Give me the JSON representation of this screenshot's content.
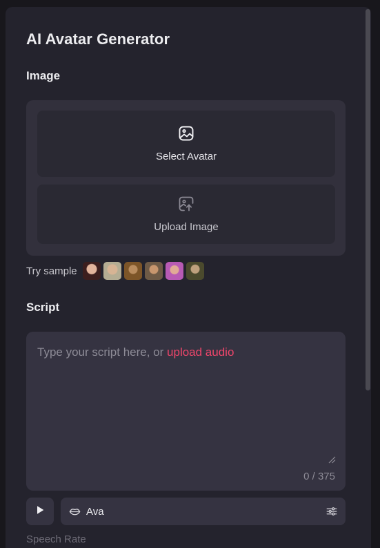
{
  "app": {
    "title": "AI Avatar Generator"
  },
  "image_section": {
    "label": "Image",
    "select_avatar_label": "Select Avatar",
    "upload_image_label": "Upload Image",
    "try_sample_label": "Try sample",
    "sample_count": 6
  },
  "script_section": {
    "label": "Script",
    "placeholder_text": "Type your script here, or ",
    "upload_audio_label": "upload audio",
    "char_count": "0 / 375"
  },
  "voice": {
    "play_icon": "play-icon",
    "voice_icon": "lips-icon",
    "name": "Ava",
    "settings_icon": "sliders-icon"
  },
  "speech_rate": {
    "label": "Speech Rate"
  },
  "colors": {
    "background": "#18171c",
    "panel": "#24232d",
    "accent": "#f0466b",
    "text_primary": "#ececef",
    "text_muted": "#8d8b96"
  }
}
